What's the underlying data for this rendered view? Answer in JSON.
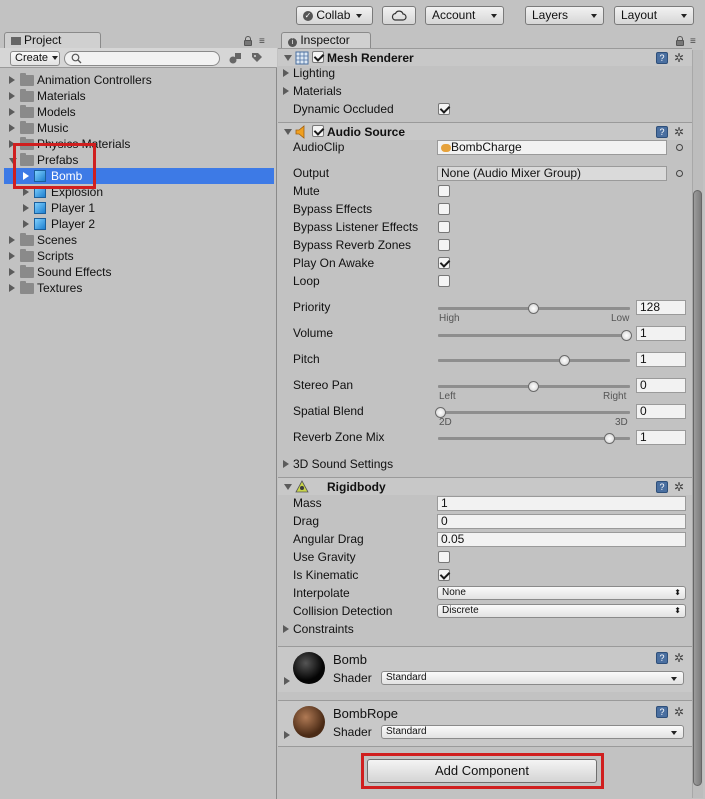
{
  "toolbar": {
    "collab_label": "Collab",
    "account_label": "Account",
    "layers_label": "Layers",
    "layout_label": "Layout"
  },
  "project_panel": {
    "tab_label": "Project",
    "create_label": "Create",
    "search_placeholder": "",
    "tree": [
      {
        "label": "Animation Controllers",
        "type": "folder",
        "depth": 0,
        "expanded": false
      },
      {
        "label": "Materials",
        "type": "folder",
        "depth": 0,
        "expanded": false
      },
      {
        "label": "Models",
        "type": "folder",
        "depth": 0,
        "expanded": false
      },
      {
        "label": "Music",
        "type": "folder",
        "depth": 0,
        "expanded": false
      },
      {
        "label": "Physics Materials",
        "type": "folder",
        "depth": 0,
        "expanded": false
      },
      {
        "label": "Prefabs",
        "type": "folder",
        "depth": 0,
        "expanded": true
      },
      {
        "label": "Bomb",
        "type": "prefab",
        "depth": 1,
        "selected": true
      },
      {
        "label": "Explosion",
        "type": "prefab",
        "depth": 1
      },
      {
        "label": "Player 1",
        "type": "prefab",
        "depth": 1
      },
      {
        "label": "Player 2",
        "type": "prefab",
        "depth": 1
      },
      {
        "label": "Scenes",
        "type": "folder",
        "depth": 0,
        "expanded": false
      },
      {
        "label": "Scripts",
        "type": "folder",
        "depth": 0,
        "expanded": false
      },
      {
        "label": "Sound Effects",
        "type": "folder",
        "depth": 0,
        "expanded": false
      },
      {
        "label": "Textures",
        "type": "folder",
        "depth": 0,
        "expanded": false
      }
    ]
  },
  "inspector": {
    "tab_label": "Inspector",
    "mesh_renderer": {
      "title": "Mesh Renderer",
      "lighting_label": "Lighting",
      "materials_label": "Materials",
      "dynamic_occluded_label": "Dynamic Occluded",
      "dynamic_occluded": true
    },
    "audio_source": {
      "title": "Audio Source",
      "audioclip_label": "AudioClip",
      "audioclip_value": "BombCharge",
      "output_label": "Output",
      "output_value": "None (Audio Mixer Group)",
      "mute_label": "Mute",
      "bypass_effects_label": "Bypass Effects",
      "bypass_listener_label": "Bypass Listener Effects",
      "bypass_reverb_label": "Bypass Reverb Zones",
      "play_on_awake_label": "Play On Awake",
      "loop_label": "Loop",
      "priority_label": "Priority",
      "priority_value": "128",
      "priority_high": "High",
      "priority_low": "Low",
      "volume_label": "Volume",
      "volume_value": "1",
      "pitch_label": "Pitch",
      "pitch_value": "1",
      "stereo_pan_label": "Stereo Pan",
      "stereo_pan_value": "0",
      "stereo_left": "Left",
      "stereo_right": "Right",
      "spatial_blend_label": "Spatial Blend",
      "spatial_blend_value": "0",
      "spatial_2d": "2D",
      "spatial_3d": "3D",
      "reverb_mix_label": "Reverb Zone Mix",
      "reverb_mix_value": "1",
      "sound_settings_label": "3D Sound Settings"
    },
    "rigidbody": {
      "title": "Rigidbody",
      "mass_label": "Mass",
      "mass_value": "1",
      "drag_label": "Drag",
      "drag_value": "0",
      "angular_drag_label": "Angular Drag",
      "angular_drag_value": "0.05",
      "use_gravity_label": "Use Gravity",
      "is_kinematic_label": "Is Kinematic",
      "interpolate_label": "Interpolate",
      "interpolate_value": "None",
      "collision_label": "Collision Detection",
      "collision_value": "Discrete",
      "constraints_label": "Constraints"
    },
    "materials": [
      {
        "name": "Bomb",
        "shader_label": "Shader",
        "shader_value": "Standard"
      },
      {
        "name": "BombRope",
        "shader_label": "Shader",
        "shader_value": "Standard"
      }
    ],
    "add_component_label": "Add Component"
  }
}
